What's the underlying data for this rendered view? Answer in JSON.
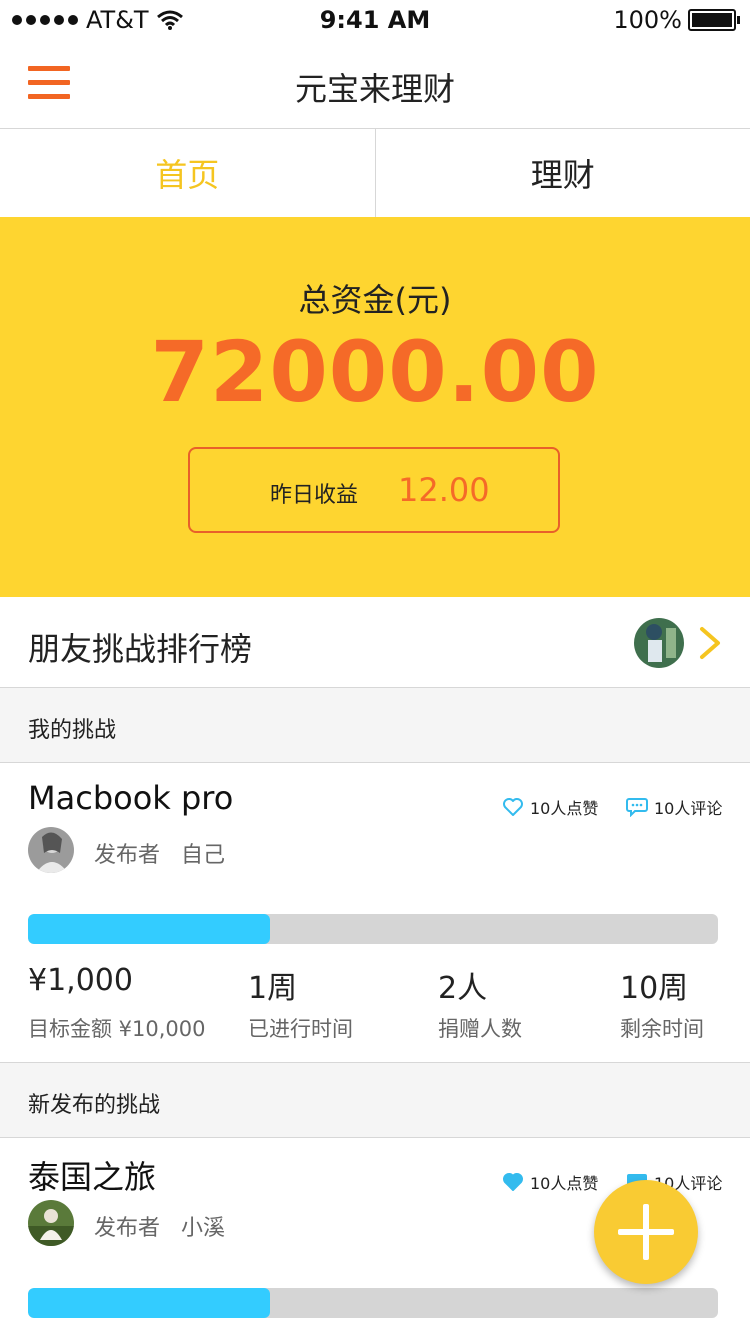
{
  "status_bar": {
    "carrier": "AT&T",
    "time": "9:41 AM",
    "battery": "100%"
  },
  "nav": {
    "title": "元宝来理财"
  },
  "tabs": [
    {
      "label": "首页",
      "active": true
    },
    {
      "label": "理财",
      "active": false
    }
  ],
  "hero": {
    "label": "总资金(元)",
    "amount": "72000.00",
    "yesterday_label": "昨日收益",
    "yesterday_value": "12.00"
  },
  "ranking": {
    "title": "朋友挑战排行榜"
  },
  "my_challenges": {
    "section_title": "我的挑战",
    "card": {
      "title": "Macbook  pro",
      "likes": "10人点赞",
      "comments": "10人评论",
      "publisher_label": "发布者",
      "publisher_name": "自己",
      "progress": 0.35,
      "stats": [
        {
          "value": "¥1,000",
          "label": "目标金额 ¥10,000"
        },
        {
          "value": "1周",
          "label": "已进行时间"
        },
        {
          "value": "2人",
          "label": "捐赠人数"
        },
        {
          "value": "10周",
          "label": "剩余时间"
        }
      ]
    }
  },
  "new_challenges": {
    "section_title": "新发布的挑战",
    "card": {
      "title": "泰国之旅",
      "likes": "10人点赞",
      "comments": "10人评论",
      "publisher_label": "发布者",
      "publisher_name": "小溪",
      "progress": 0.35
    }
  },
  "colors": {
    "accent_orange": "#f56a28",
    "accent_yellow": "#fed530",
    "progress_blue": "#33ccff",
    "tab_active": "#f5c520"
  },
  "icons": [
    "signal-dots-icon",
    "wifi-icon",
    "battery-icon",
    "menu-icon",
    "chevron-right-icon",
    "heart-icon",
    "comment-icon",
    "plus-icon"
  ]
}
